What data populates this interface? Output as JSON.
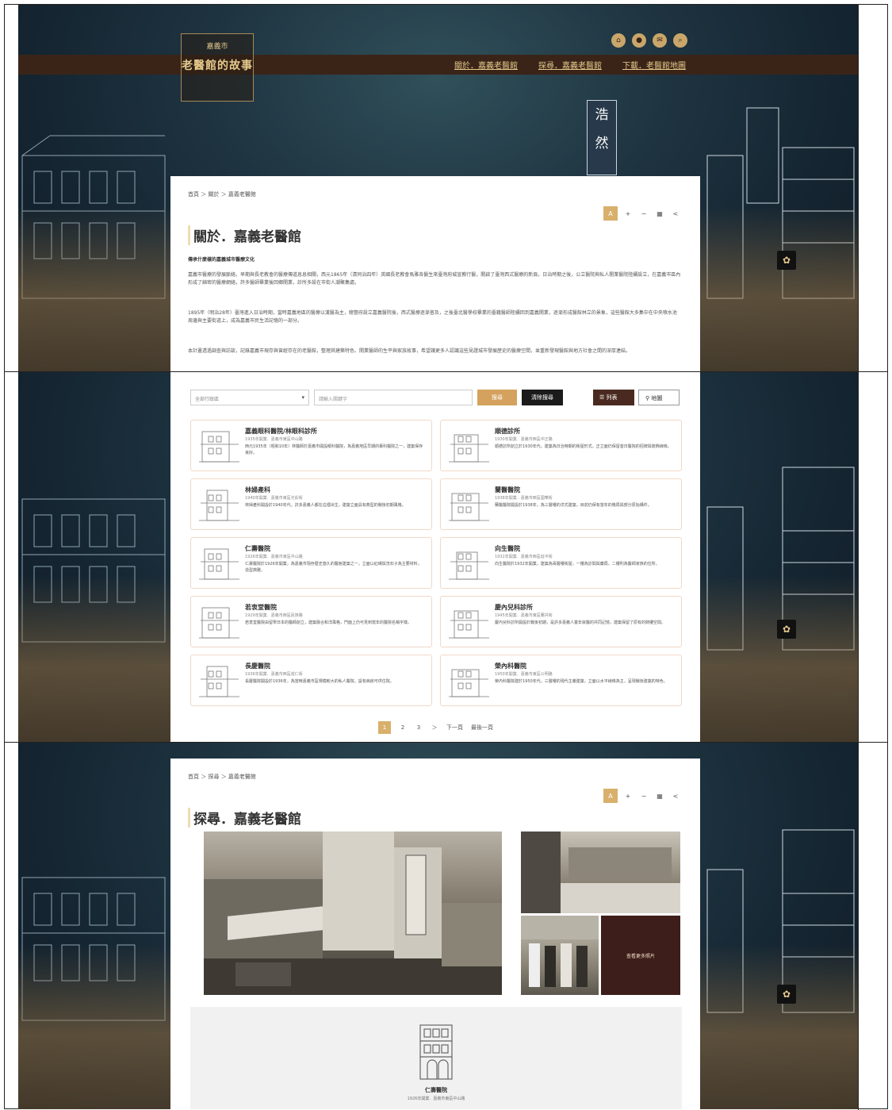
{
  "site": {
    "logo_sub": "嘉義市",
    "logo_title": "老醫館的故事",
    "nav": [
      "關於．嘉義老醫館",
      "探尋．嘉義老醫館",
      "下載．老醫館地圖"
    ],
    "top_icons": [
      "home-icon",
      "user-icon",
      "mail-icon",
      "search-icon"
    ],
    "tower_sign": [
      "浩",
      "然"
    ]
  },
  "about": {
    "breadcrumb": "首頁 ＞ 關於 ＞ 嘉義老醫館",
    "title": "關於．嘉義老醫館",
    "lead": "傳承什麼樣的嘉義城市醫療文化",
    "paragraphs": [
      "嘉義市醫療的發展脈絡，早期與長老教會的醫療傳道息息相關，西元1865年（清同治四年）英國長老教會馬雅各醫生來臺灣府城宣教行醫，開啟了臺灣西式醫療的新頁。日治時期之後，公立醫院與私人開業醫院陸續設立，在嘉義市區內形成了綿密的醫療網絡，許多醫師畢業後回鄉開業，診所多設在市街人潮聚集處。",
      "1895年（明治28年）臺灣進入日治時期，當時嘉義地區的醫療以漢醫為主，總督府設立嘉義醫院後，西式醫療逐漸普及，之後臺北醫學校畢業的臺籍醫師陸續回到嘉義開業，逐漸形成醫館林立的景象，這些醫館大多集中在中央噴水池周邊與主要街道上，成為嘉義市民生活記憶的一部分。",
      "本計畫透過調查與訪談，記錄嘉義市現存與曾經存在的老醫館，整理其建築特色、開業醫師的生平與家族故事，希望讓更多人認識這些見證城市發展歷史的醫療空間，並重新發現醫館與地方社會之間的深厚連結。"
    ]
  },
  "explore_list": {
    "district_placeholder": "全部行政區",
    "keyword_placeholder": "請輸入關鍵字",
    "search_label": "搜尋",
    "clear_label": "清除搜尋",
    "list_view_label": "列表",
    "map_view_label": "地圖",
    "items": [
      {
        "name": "嘉義眼科醫院/林眼科診所",
        "meta": "1935年開業．嘉義市東區中山路",
        "desc": "西元1935年（昭和10年）林醫師於嘉義市開設眼科醫院，為嘉義地區早期的專科醫院之一，建築保存良好。"
      },
      {
        "name": "順德診所",
        "meta": "1930年開業．嘉義市西區中正路",
        "desc": "順德診所創立於1930年代，建築為日治時期的街屋形式，正立面仍保留昔日醫院的招牌與裝飾線條。"
      },
      {
        "name": "林婦產科",
        "meta": "1940年開業．嘉義市東區光彩街",
        "desc": "林婦產科開設於1940年代，許多嘉義人都在這裡出生，建築立面具有典型的戰後初期風格。"
      },
      {
        "name": "蘭醫醫院",
        "meta": "1938年開業．嘉義市西區國華街",
        "desc": "蘭醫醫院開設於1938年，為三層樓的洋式建築，目前仍保有當年的格局與部分原始構件。"
      },
      {
        "name": "仁壽醫院",
        "meta": "1926年開業．嘉義市東區中山路",
        "desc": "仁壽醫院於1926年開業，為嘉義市現存歷史悠久的醫館建築之一，立面以紅磚與洗石子為主要材料，造型典雅。"
      },
      {
        "name": "向生醫院",
        "meta": "1932年開業．嘉義市西區延平街",
        "desc": "向生醫院於1932年開業，建築為兩層樓街屋，一樓為診間與藥局，二樓則為醫師家族的住所。"
      },
      {
        "name": "若衷堂醫院",
        "meta": "1929年開業．嘉義市西區民族路",
        "desc": "若衷堂醫院由留學日本的醫師創立，建築融合和洋風格，門面上仍可見到當年的醫院名稱字樣。"
      },
      {
        "name": "慶內兒科診所",
        "meta": "1945年開業．嘉義市東區蘭井街",
        "desc": "慶內兒科診所開設於戰後初期，是許多嘉義人童年就醫的共同記憶，建築保留了原有的騎樓空間。"
      },
      {
        "name": "長慶醫院",
        "meta": "1936年開業．嘉義市西區成仁街",
        "desc": "長慶醫院開設於1936年，為當時嘉義市區規模較大的私人醫院，設有病房可供住院。"
      },
      {
        "name": "榮內科醫院",
        "meta": "1950年開業．嘉義市東區公明路",
        "desc": "榮內科醫院建於1950年代，三層樓的現代主義建築，立面以水平線條為主，呈現戰後建築的特色。"
      }
    ],
    "pagination": [
      "1",
      "2",
      "3",
      "＞",
      "下一頁",
      "最後一頁"
    ]
  },
  "explore_detail": {
    "breadcrumb": "首頁 ＞ 探尋 ＞ 嘉義老醫館",
    "title": "探尋．嘉義老醫館",
    "more_photos_label": "查看更多照片",
    "feature_name": "仁壽醫院",
    "feature_meta": "1926年開業．嘉義市東區中山路"
  },
  "toolbar_icons": [
    "font-size-icon",
    "zoom-in-icon",
    "zoom-out-icon",
    "print-icon",
    "share-icon"
  ],
  "colors": {
    "accent": "#d8b06b",
    "nav_bg": "#3a2418",
    "dark_brown": "#4a2a20",
    "gold_text": "#e6c98c"
  }
}
